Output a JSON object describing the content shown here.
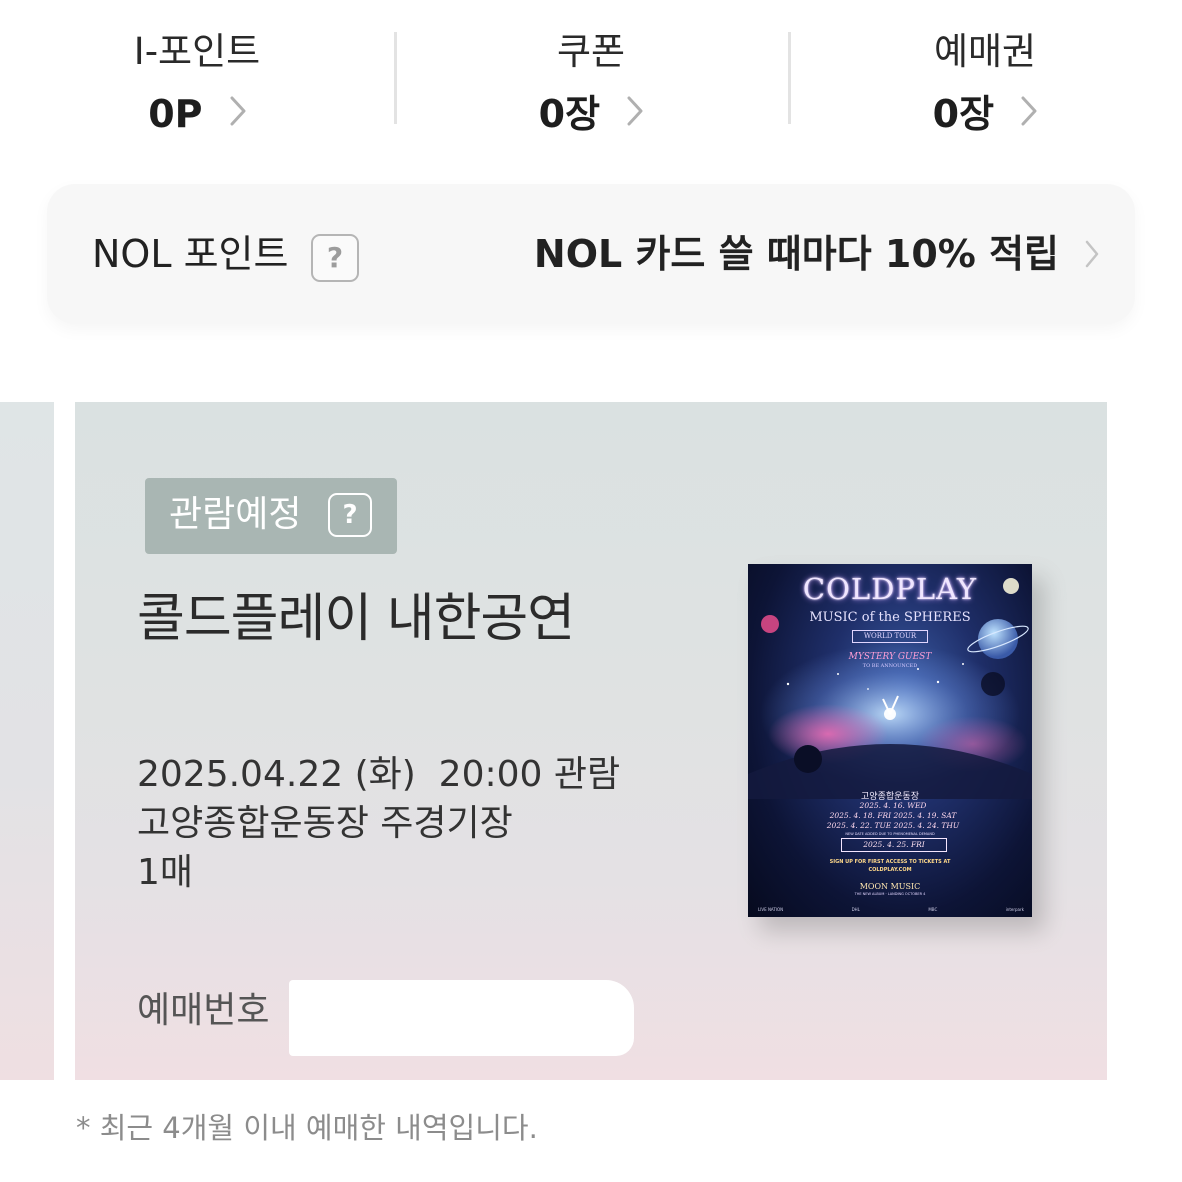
{
  "stats": [
    {
      "label": "I-포인트",
      "value": "0P"
    },
    {
      "label": "쿠폰",
      "value": "0장"
    },
    {
      "label": "예매권",
      "value": "0장"
    }
  ],
  "nol": {
    "title": "NOL 포인트",
    "help": "?",
    "promo": "NOL 카드 쓸 때마다 10% 적립"
  },
  "ticket": {
    "status": "관람예정",
    "status_help": "?",
    "title": "콜드플레이 내한공연",
    "datetime": "2025.04.22 (화)  20:00 관람",
    "venue": "고양종합운동장 주경기장",
    "quantity": "1매",
    "booking_label": "예매번호",
    "poster": {
      "title": "COLDPLAY",
      "subtitle": "MUSIC of the SPHERES",
      "tour": "WORLD TOUR",
      "guest": "MYSTERY GUEST",
      "guest_sub": "TO BE ANNOUNCED",
      "venue": "고양종합운동장",
      "dates": [
        "2025. 4. 16. WED",
        "2025. 4. 18. FRI   2025. 4. 19. SAT",
        "2025. 4. 22. TUE   2025. 4. 24. THU"
      ],
      "new_date_note": "NEW DATE ADDED DUE TO PHENOMENAL DEMAND",
      "new_date": "2025. 4. 25. FRI",
      "signup": "SIGN UP FOR FIRST ACCESS TO TICKETS AT",
      "site": "COLDPLAY.COM",
      "album": "MOON MUSIC",
      "album_sub": "THE NEW ALBUM · LANDING OCTOBER 4",
      "sponsors": [
        "LIVE NATION",
        "DHL",
        "MBC",
        "interpark"
      ]
    }
  },
  "footnote": "* 최근 4개월 이내 예매한 내역입니다.",
  "colors": {
    "badge": "#a9b6b3",
    "nol_bg": "#f7f7f7",
    "ticket_top": "#dae1e1",
    "ticket_bottom": "#f0dfe3"
  },
  "icons": [
    "chevron-right-icon",
    "question-icon"
  ]
}
